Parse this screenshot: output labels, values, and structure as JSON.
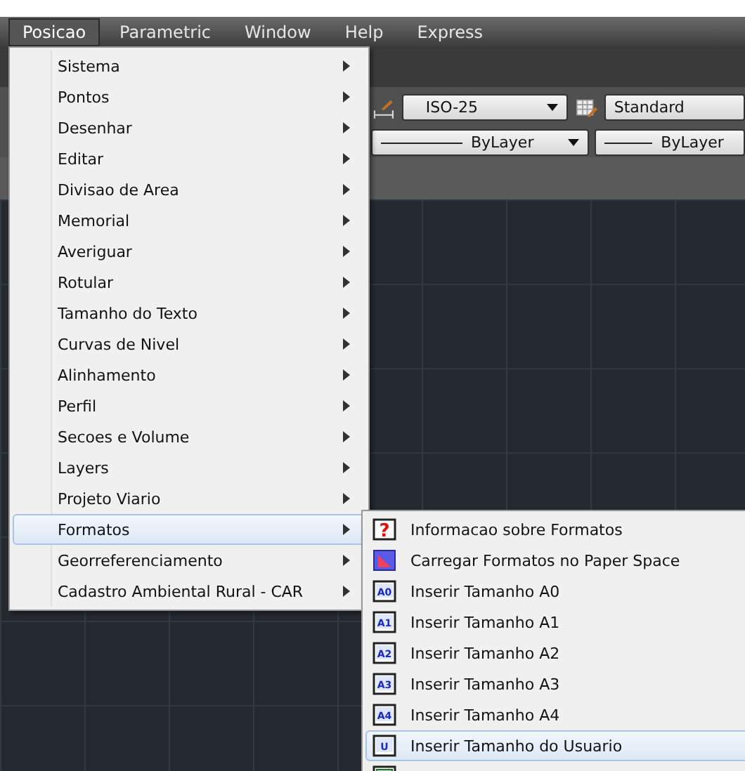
{
  "menubar": [
    {
      "label": "Posicao",
      "selected": true
    },
    {
      "label": "Parametric",
      "selected": false
    },
    {
      "label": "Window",
      "selected": false
    },
    {
      "label": "Help",
      "selected": false
    },
    {
      "label": "Express",
      "selected": false
    }
  ],
  "toolbar": {
    "dimstyle": "ISO-25",
    "tablestyle": "Standard",
    "linetype": "ByLayer",
    "lineweight": "ByLayer"
  },
  "menu": {
    "items": [
      {
        "label": "Sistema",
        "selected": false
      },
      {
        "label": "Pontos",
        "selected": false
      },
      {
        "label": "Desenhar",
        "selected": false
      },
      {
        "label": "Editar",
        "selected": false
      },
      {
        "label": "Divisao de Area",
        "selected": false
      },
      {
        "label": "Memorial",
        "selected": false
      },
      {
        "label": "Averiguar",
        "selected": false
      },
      {
        "label": "Rotular",
        "selected": false
      },
      {
        "label": "Tamanho do Texto",
        "selected": false
      },
      {
        "label": "Curvas de Nivel",
        "selected": false
      },
      {
        "label": "Alinhamento",
        "selected": false
      },
      {
        "label": "Perfil",
        "selected": false
      },
      {
        "label": "Secoes e Volume",
        "selected": false
      },
      {
        "label": "Layers",
        "selected": false
      },
      {
        "label": "Projeto Viario",
        "selected": false
      },
      {
        "label": "Formatos",
        "selected": true
      },
      {
        "label": "Georreferenciamento",
        "selected": false
      },
      {
        "label": "Cadastro Ambiental Rural - CAR",
        "selected": false
      }
    ]
  },
  "submenu": {
    "items": [
      {
        "kind": "help",
        "badge": "?",
        "label": "Informacao sobre Formatos",
        "selected": false
      },
      {
        "kind": "paper",
        "label": "Carregar Formatos no Paper Space",
        "selected": false
      },
      {
        "kind": "sheet",
        "badge": "A0",
        "label": "Inserir Tamanho A0",
        "selected": false
      },
      {
        "kind": "sheet",
        "badge": "A1",
        "label": "Inserir Tamanho A1",
        "selected": false
      },
      {
        "kind": "sheet",
        "badge": "A2",
        "label": "Inserir Tamanho A2",
        "selected": false
      },
      {
        "kind": "sheet",
        "badge": "A3",
        "label": "Inserir Tamanho A3",
        "selected": false
      },
      {
        "kind": "sheet",
        "badge": "A4",
        "label": "Inserir Tamanho A4",
        "selected": false
      },
      {
        "kind": "sheet",
        "badge": "U",
        "label": "Inserir Tamanho do Usuario",
        "selected": true
      },
      {
        "kind": "area",
        "selected": false
      }
    ]
  }
}
